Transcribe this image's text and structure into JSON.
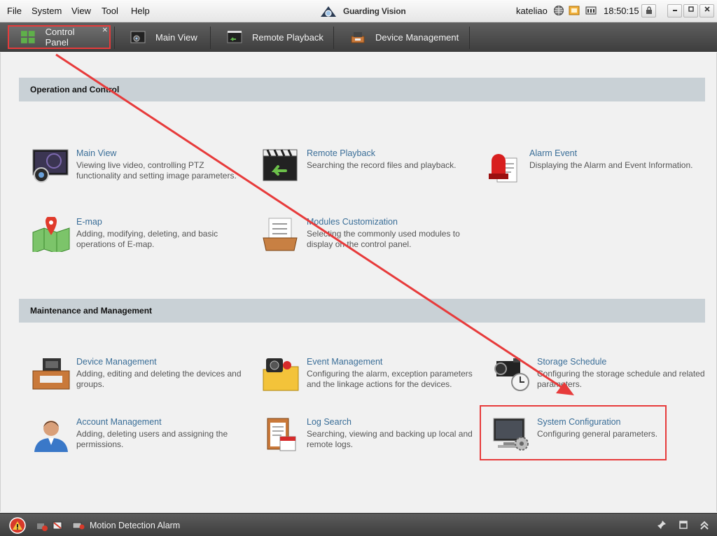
{
  "menu": [
    "File",
    "System",
    "View",
    "Tool",
    "Help"
  ],
  "app_title": "Guarding Vision",
  "user": "kateliao",
  "status_icons": [
    "globe-icon",
    "cpu-icon",
    "ram-icon"
  ],
  "clock": "18:50:15",
  "tabs": [
    {
      "label": "Control Panel",
      "icon": "grid-icon",
      "active": true
    },
    {
      "label": "Main View",
      "icon": "camera-icon"
    },
    {
      "label": "Remote Playback",
      "icon": "playback-icon"
    },
    {
      "label": "Device Management",
      "icon": "device-icon"
    }
  ],
  "sections": [
    {
      "title": "Operation and Control",
      "modules": [
        {
          "title": "Main View",
          "desc": "Viewing live video, controlling PTZ functionality and setting image parameters."
        },
        {
          "title": "Remote Playback",
          "desc": "Searching the record files and playback."
        },
        {
          "title": "Alarm Event",
          "desc": "Displaying the Alarm and Event Information."
        },
        {
          "title": "E-map",
          "desc": "Adding, modifying, deleting, and basic operations of E-map."
        },
        {
          "title": "Modules Customization",
          "desc": "Selecting the commonly used modules to display on the control panel."
        }
      ]
    },
    {
      "title": "Maintenance and Management",
      "modules": [
        {
          "title": "Device Management",
          "desc": "Adding, editing and deleting the devices and groups."
        },
        {
          "title": "Event Management",
          "desc": "Configuring the alarm, exception parameters and the linkage actions for the devices."
        },
        {
          "title": "Storage Schedule",
          "desc": "Configuring the storage schedule and related parameters."
        },
        {
          "title": "Account Management",
          "desc": "Adding, deleting users and assigning the permissions."
        },
        {
          "title": "Log Search",
          "desc": "Searching, viewing and backing up local and remote logs."
        },
        {
          "title": "System Configuration",
          "desc": "Configuring general parameters."
        }
      ]
    }
  ],
  "status_bar": {
    "alarm_label": "Motion Detection Alarm"
  },
  "colors": {
    "highlight": "#e73b3b",
    "module_title": "#3a6e98",
    "section_header": "#c9d1d6"
  }
}
